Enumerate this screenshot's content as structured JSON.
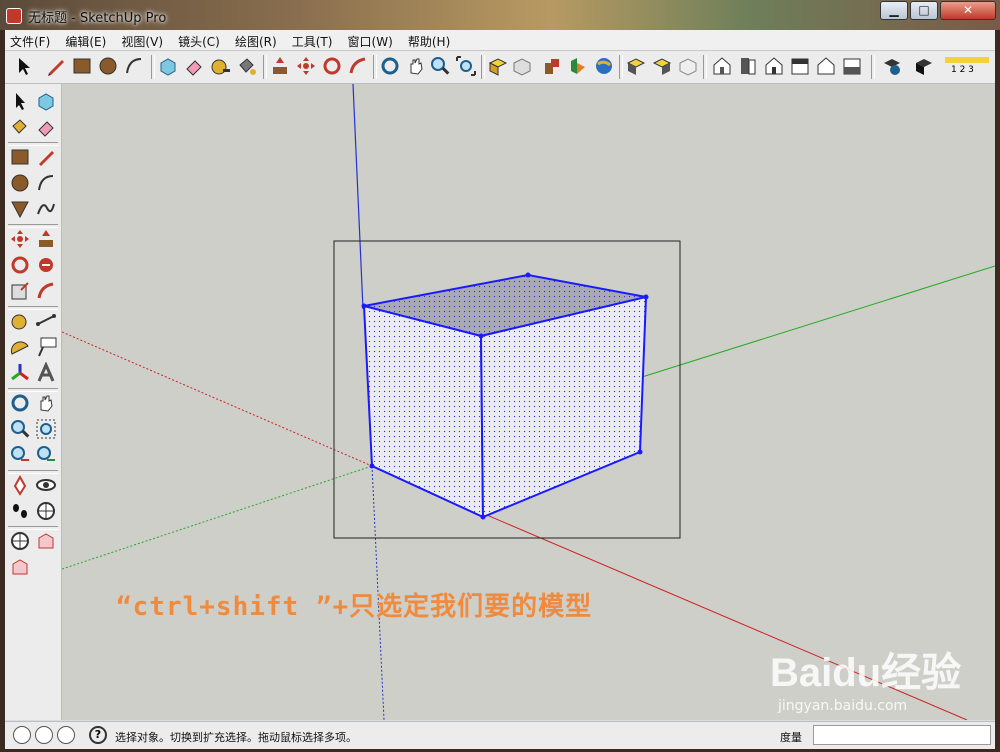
{
  "window": {
    "title": "无标题 - SketchUp Pro"
  },
  "menu": [
    "文件(F)",
    "编辑(E)",
    "视图(V)",
    "镜头(C)",
    "绘图(R)",
    "工具(T)",
    "窗口(W)",
    "帮助(H)"
  ],
  "toolbar_icons": [
    "select-icon",
    "pencil-icon",
    "rectangle-icon",
    "circle-icon",
    "arc-icon",
    "make-component-icon",
    "eraser-icon",
    "tape-measure-icon",
    "paint-bucket-icon",
    "push-pull-icon",
    "move-icon",
    "rotate-icon",
    "offset-icon",
    "orbit-icon",
    "pan-icon",
    "zoom-icon",
    "zoom-extents-icon",
    "get-models-icon",
    "share-model-icon",
    "components-icon",
    "3d-warehouse-icon",
    "google-earth-icon",
    "section-plane-icon",
    "standard-views-icon",
    "iso-view-icon",
    "top-view-icon",
    "front-view-icon",
    "right-view-icon",
    "back-view-icon",
    "left-view-icon",
    "model-info-icon",
    "shadows-icon",
    "scenes-icon"
  ],
  "scenes_label": "1 2 3",
  "caption": "“ctrl+shift ”+只选定我们要的模型",
  "status": {
    "text": "选择对象。切换到扩充选择。拖动鼠标选择多项。",
    "measure_label": "度量",
    "measure_value": ""
  },
  "watermark": {
    "logo": "Baidu经验",
    "url": "jingyan.baidu.com"
  },
  "colors": {
    "red_axis": "#cc2222",
    "green_axis": "#22aa22",
    "blue_axis": "#2233cc",
    "selection": "#1a1aff",
    "caption": "#f08a3c",
    "viewport": "#cfcfca"
  }
}
